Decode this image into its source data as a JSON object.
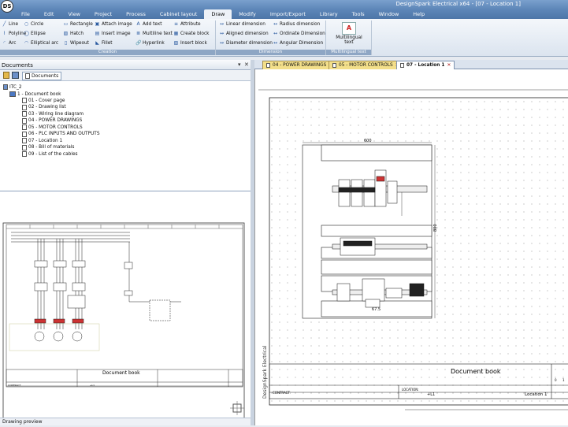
{
  "app": {
    "title": "DesignSpark Electrical x64 - [07 - Location 1]",
    "logo": "DS"
  },
  "ribbon_tabs": [
    "File",
    "Edit",
    "View",
    "Project",
    "Process",
    "Cabinet layout",
    "Draw",
    "Modify",
    "Import/Export",
    "Library",
    "Tools",
    "Window",
    "Help"
  ],
  "active_tab": "Draw",
  "ribbon": {
    "creation": {
      "label": "Creation",
      "items": [
        "Line",
        "Circle",
        "Rectangle",
        "Attach image",
        "Add text",
        "Attribute",
        "Polyline",
        "Ellipse",
        "Hatch",
        "Insert image",
        "Multiline text",
        "Create block",
        "Arc",
        "Elliptical arc",
        "Wipeout",
        "Fillet",
        "Hyperlink",
        "Insert block"
      ]
    },
    "dimension": {
      "label": "Dimension",
      "items": [
        "Linear dimension",
        "Radius dimension",
        "Aligned dimension",
        "Ordinate Dimension",
        "Diameter dimension",
        "Angular Dimension"
      ]
    },
    "multilingual": {
      "label": "Multilingual text",
      "button": "Multilingual text"
    }
  },
  "documents_panel": {
    "title": "Documents",
    "tab": "Documents",
    "project": "ITC_2",
    "book": "1 - Document book",
    "pages": [
      "01 - Cover page",
      "02 - Drawing list",
      "03 - Wiring line diagram",
      "04 - POWER DRAWINGS",
      "05 - MOTOR CONTROLS",
      "06 - PLC INPUTS AND OUTPUTS",
      "07 - Location 1",
      "08 - Bill of materials",
      "09 - List of the cables"
    ]
  },
  "preview": {
    "label": "Drawing preview",
    "title_block": "Document book",
    "contract_label": "CONTRACT",
    "location_code": "+L1"
  },
  "doc_tabs": [
    {
      "label": "04 - POWER DRAWINGS",
      "active": false
    },
    {
      "label": "05 - MOTOR CONTROLS",
      "active": false
    },
    {
      "label": "07 - Location 1",
      "active": true
    }
  ],
  "drawing": {
    "title_block": "Document book",
    "location_label": "LOCATION:",
    "location_code": "+L1",
    "location_name": "Location 1",
    "contract_label": "CONTRACT:",
    "vertical_brand": "DesignSpark Electrical",
    "dim_width": "600",
    "dim_height": "800",
    "dim_small": "67.5",
    "tb_numbers": [
      "0",
      "1"
    ]
  }
}
